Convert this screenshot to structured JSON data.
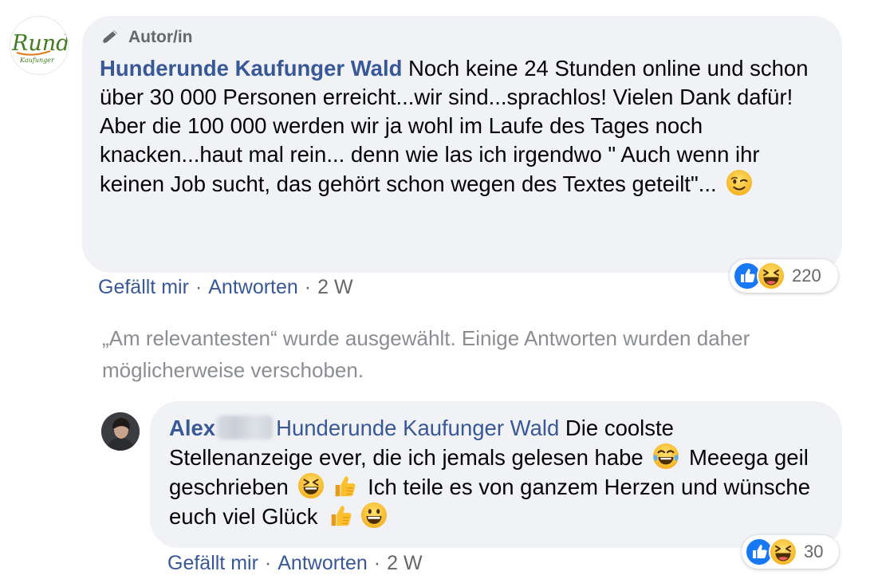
{
  "main_comment": {
    "avatar_logo_text": "Runde",
    "avatar_logo_subtext": "Kaufunger",
    "author_badge": "Autor/in",
    "author_name": "Hunderunde Kaufunger Wald",
    "text_line1": " Noch keine 24 Stunden online und schon über 30 000 Personen erreicht...wir sind...sprachlos! Vielen Dank dafür!",
    "text_line2": "Aber die 100 000 werden wir ja wohl im Laufe des Tages noch knacken...haut mal rein... denn wie las ich irgendwo \" Auch wenn ihr keinen Job sucht, das gehört schon wegen des Textes geteilt\"...",
    "text_end_emoji": "winking-face",
    "like_label": "Gefällt mir",
    "reply_label": "Antworten",
    "separator": "·",
    "time": "2 W",
    "reaction_count": "220",
    "reaction_types": [
      "like",
      "haha"
    ]
  },
  "sort_notice": "„Am relevantesten“ wurde ausgewählt. Einige Antworten wurden daher möglicherweise verschoben.",
  "reply_comment": {
    "author_name": "Alex",
    "tagged_page": "Hunderunde Kaufunger Wald",
    "text_part1": " Die coolste Stellenanzeige ever, die ich jemals gelesen habe",
    "text_part2": " Meeega geil geschrieben",
    "text_part3": " Ich teile es von ganzem Herzen und wünsche euch viel Glück",
    "emojis": [
      "tears-of-joy",
      "grinning-squinting",
      "thumbs-up",
      "thumbs-up",
      "grinning"
    ],
    "like_label": "Gefällt mir",
    "reply_label": "Antworten",
    "separator": "·",
    "time": "2 W",
    "reaction_count": "30",
    "reaction_types": [
      "like",
      "haha"
    ]
  },
  "colors": {
    "link_blue": "#385898",
    "bubble_bg": "#f0f2f5",
    "secondary_text": "#65676b",
    "like_blue": "#1877f2",
    "haha_yellow": "#f7b125"
  }
}
